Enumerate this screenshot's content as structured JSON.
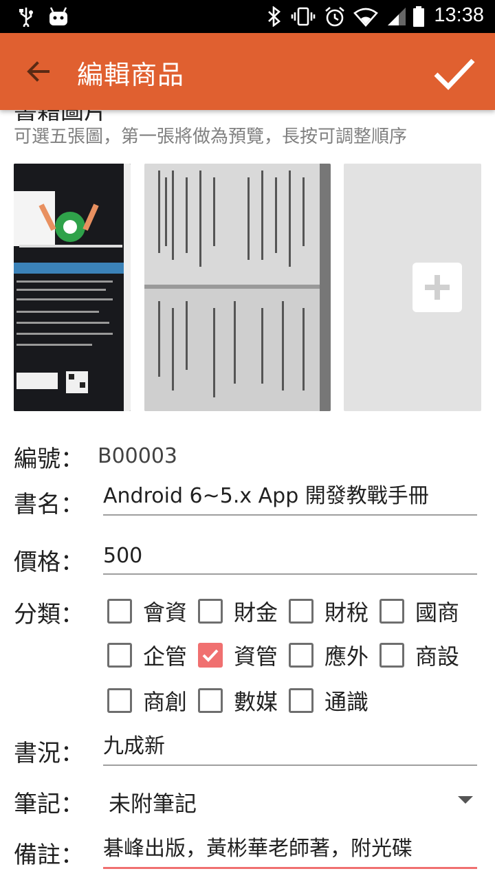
{
  "status_bar": {
    "time": "13:38",
    "icons": [
      "usb-icon",
      "android-icon",
      "bluetooth-icon",
      "vibrate-icon",
      "alarm-icon",
      "wifi-icon",
      "cell-signal-icon",
      "battery-icon"
    ]
  },
  "app_bar": {
    "title": "編輯商品",
    "back_icon": "arrow-back-icon",
    "confirm_icon": "check-icon",
    "color": "#e06030"
  },
  "images_section": {
    "title": "書籍圖片",
    "hint": "可選五張圖，第一張將做為預覽，長按可調整順序",
    "add_icon": "plus-icon"
  },
  "form": {
    "id_label": "編號：",
    "id_value": "B00003",
    "title_label": "書名：",
    "title_value": "Android 6~5.x App 開發教戰手冊",
    "price_label": "價格：",
    "price_value": "500",
    "category_label": "分類：",
    "categories": [
      {
        "label": "會資",
        "checked": false
      },
      {
        "label": "財金",
        "checked": false
      },
      {
        "label": "財稅",
        "checked": false
      },
      {
        "label": "國商",
        "checked": false
      },
      {
        "label": "企管",
        "checked": false
      },
      {
        "label": "資管",
        "checked": true
      },
      {
        "label": "應外",
        "checked": false
      },
      {
        "label": "商設",
        "checked": false
      },
      {
        "label": "商創",
        "checked": false
      },
      {
        "label": "數媒",
        "checked": false
      },
      {
        "label": "通識",
        "checked": false
      }
    ],
    "condition_label": "書況：",
    "condition_value": "九成新",
    "notes_label": "筆記：",
    "notes_value": "未附筆記",
    "remark_label": "備註：",
    "remark_value": "碁峰出版，黃彬華老師著，附光碟"
  },
  "colors": {
    "accent": "#f07070",
    "primary": "#e06030"
  }
}
